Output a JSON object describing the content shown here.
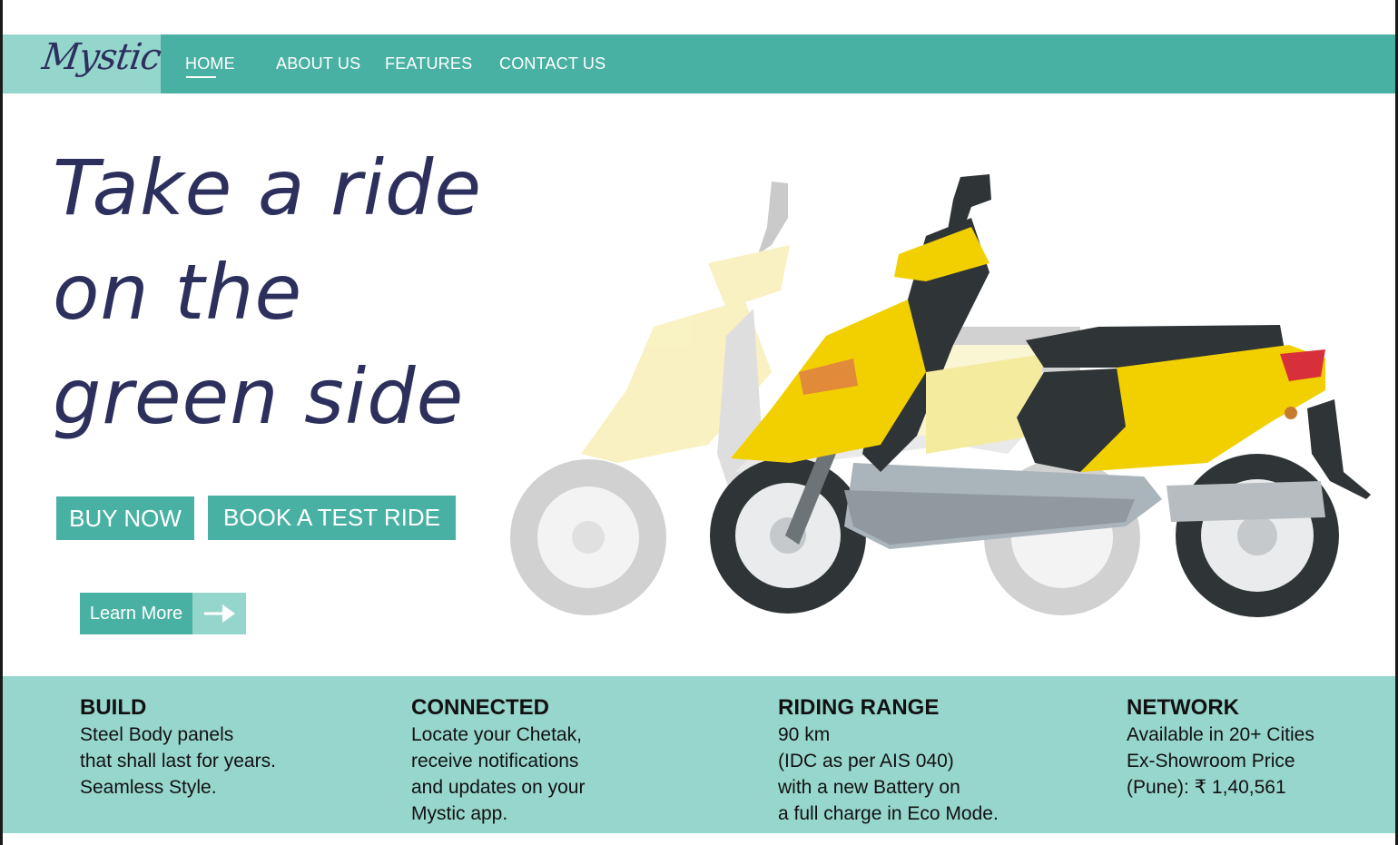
{
  "brand": {
    "logo": "Mystic"
  },
  "nav": {
    "items": [
      {
        "label": "HOME",
        "active": true
      },
      {
        "label": "ABOUT US"
      },
      {
        "label": "FEATURES"
      },
      {
        "label": "CONTACT US"
      }
    ]
  },
  "hero": {
    "title_lines": [
      "Take a ride",
      "on the",
      "green side"
    ],
    "buy_label": "BUY NOW",
    "test_ride_label": "BOOK A TEST RIDE",
    "learn_more_label": "Learn More",
    "image": "scooter-illustration"
  },
  "features": [
    {
      "title": "BUILD",
      "lines": [
        "Steel Body panels",
        "that shall last for years.",
        "Seamless Style."
      ]
    },
    {
      "title": "CONNECTED",
      "lines": [
        "Locate your Chetak,",
        "receive notifications",
        "and updates on your",
        "Mystic app."
      ]
    },
    {
      "title": "RIDING RANGE",
      "lines": [
        "90 km",
        "(IDC as per AIS 040)",
        "with a new Battery on",
        "a full charge in Eco Mode."
      ]
    },
    {
      "title": "NETWORK",
      "lines": [
        "Available in 20+ Cities",
        "Ex-Showroom Price",
        "(Pune): ₹ 1,40,561"
      ]
    }
  ],
  "colors": {
    "nav_bg": "#49b1a3",
    "logo_bg": "#95d6cc",
    "features_bg": "#97d6cc",
    "heading": "#2d2f5c",
    "scooter_yellow": "#f2d000"
  },
  "icons": {
    "learn_more_arrow": "arrow-right-icon"
  }
}
